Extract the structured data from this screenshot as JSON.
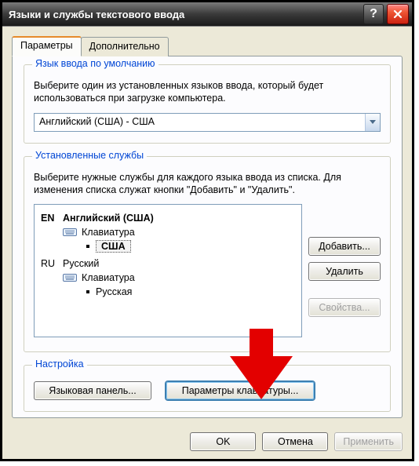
{
  "window": {
    "title": "Языки и службы текстового ввода"
  },
  "tabs": {
    "items": [
      {
        "label": "Параметры"
      },
      {
        "label": "Дополнительно"
      }
    ]
  },
  "default_lang_group": {
    "legend": "Язык ввода по умолчанию",
    "help": "Выберите один из установленных языков ввода, который будет использоваться при загрузке компьютера.",
    "combo_value": "Английский (США) - США"
  },
  "services_group": {
    "legend": "Установленные службы",
    "help": "Выберите нужные службы для каждого языка ввода из списка. Для изменения списка служат кнопки \"Добавить\" и \"Удалить\".",
    "tree": {
      "en": {
        "code": "EN",
        "name": "Английский (США)",
        "category": "Клавиатура",
        "layout": "США"
      },
      "ru": {
        "code": "RU",
        "name": "Русский",
        "category": "Клавиатура",
        "layout": "Русская"
      }
    },
    "buttons": {
      "add": "Добавить...",
      "remove": "Удалить",
      "properties": "Свойства..."
    }
  },
  "settings_group": {
    "legend": "Настройка",
    "lang_bar": "Языковая панель...",
    "key_settings": "Параметры клавиатуры..."
  },
  "dialog_buttons": {
    "ok": "OK",
    "cancel": "Отмена",
    "apply": "Применить"
  }
}
